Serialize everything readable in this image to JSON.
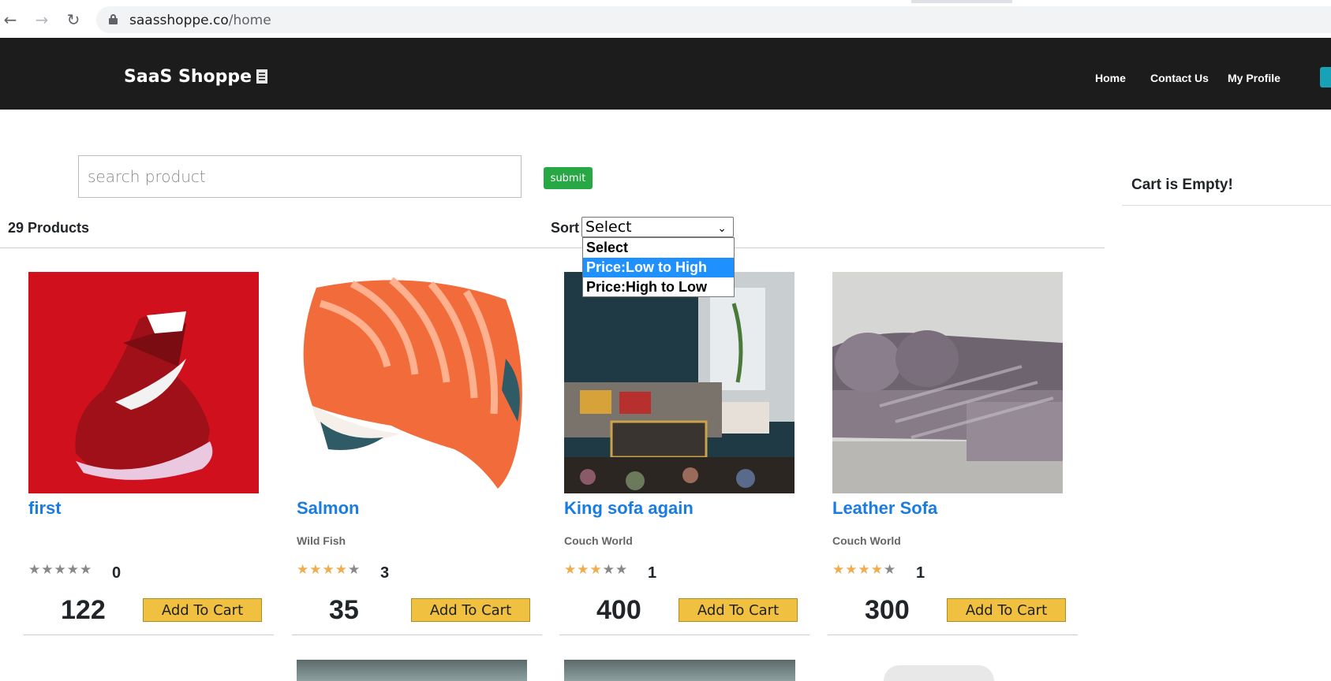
{
  "browser": {
    "url_domain": "saasshoppe.co",
    "url_path": "/home"
  },
  "navbar": {
    "brand": "SaaS Shoppe",
    "links": [
      "Home",
      "Contact Us",
      "My Profile"
    ]
  },
  "search": {
    "placeholder": "search product",
    "submit_label": "submit"
  },
  "cart": {
    "status": "Cart is Empty!"
  },
  "filter": {
    "count": "29 Products",
    "sort_label": "Sort",
    "selected": "Select",
    "options": [
      "Select",
      "Price:Low to High",
      "Price:High to Low"
    ],
    "highlighted_index": 1
  },
  "products": [
    {
      "title": "first",
      "seller": "",
      "rating": 0,
      "reviews": "0",
      "price": "122",
      "button": "Add To Cart"
    },
    {
      "title": "Salmon",
      "seller": "Wild Fish",
      "rating": 4,
      "reviews": "3",
      "price": "35",
      "button": "Add To Cart"
    },
    {
      "title": "King sofa again",
      "seller": "Couch World",
      "rating": 3,
      "reviews": "1",
      "price": "400",
      "button": "Add To Cart"
    },
    {
      "title": "Leather Sofa",
      "seller": "Couch World",
      "rating": 4,
      "reviews": "1",
      "price": "300",
      "button": "Add To Cart"
    }
  ],
  "colors": {
    "navbar": "#1c1c1c",
    "link": "#1a7ce0",
    "submit": "#28a745",
    "add_to_cart": "#f0c040",
    "star_on": "#f0ad4e",
    "highlight": "#1e90ff"
  }
}
